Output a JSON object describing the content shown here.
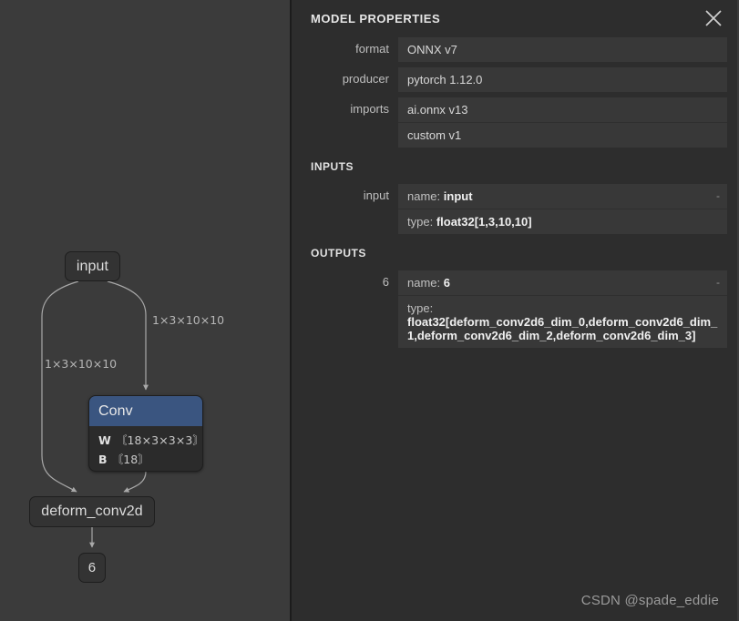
{
  "panel": {
    "title": "MODEL PROPERTIES",
    "close_icon": "close-icon",
    "properties": [
      {
        "label": "format",
        "values": [
          "ONNX v7"
        ]
      },
      {
        "label": "producer",
        "values": [
          "pytorch 1.12.0"
        ]
      },
      {
        "label": "imports",
        "values": [
          "ai.onnx v13",
          "custom v1"
        ]
      }
    ],
    "inputs_heading": "INPUTS",
    "inputs": [
      {
        "label": "input",
        "name_key": "name:",
        "name_value": "input",
        "type_key": "type:",
        "type_value": "float32[1,3,10,10]",
        "trailing": "-"
      }
    ],
    "outputs_heading": "OUTPUTS",
    "outputs": [
      {
        "label": "6",
        "name_key": "name:",
        "name_value": "6",
        "type_key": "type:",
        "type_value": "float32[deform_conv2d6_dim_0,deform_conv2d6_dim_1,deform_conv2d6_dim_2,deform_conv2d6_dim_3]",
        "trailing": "-"
      }
    ]
  },
  "graph": {
    "nodes": {
      "input": "input",
      "conv_title": "Conv",
      "conv_attrs": [
        {
          "key": "W",
          "value": "〘18×3×3×3〙"
        },
        {
          "key": "B",
          "value": "〘18〙"
        }
      ],
      "deform": "deform_conv2d",
      "output": "6"
    },
    "edge_labels": {
      "right": "1×3×10×10",
      "left": "1×3×10×10"
    }
  },
  "watermark": "CSDN @spade_eddie",
  "colors": {
    "canvas_bg": "#3b3b3b",
    "panel_bg": "#2d2d2d",
    "value_bg": "#383838",
    "conv_header": "#3a5580",
    "node_bg": "#333333",
    "text": "#d8d8d8"
  }
}
